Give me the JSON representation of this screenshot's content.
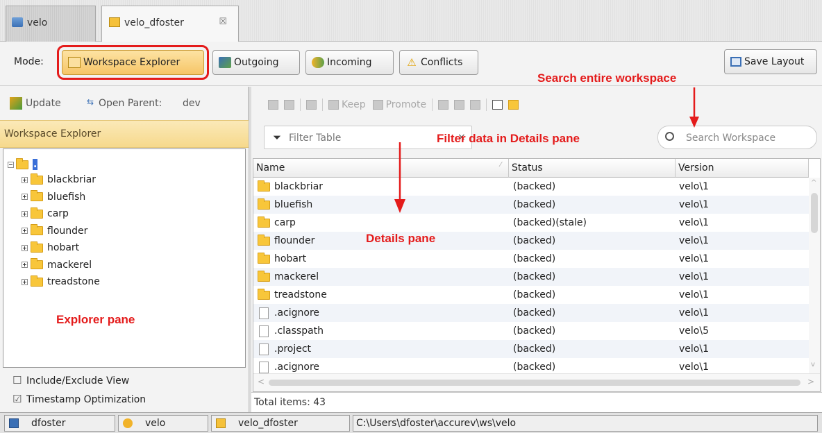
{
  "tabs": [
    {
      "label": "velo",
      "active": false
    },
    {
      "label": "velo_dfoster",
      "active": true,
      "close": "☒"
    }
  ],
  "mode": {
    "label": "Mode:",
    "buttons": [
      "Workspace Explorer",
      "Outgoing",
      "Incoming",
      "Conflicts"
    ],
    "selected": "Workspace Explorer",
    "save_layout": "Save Layout"
  },
  "left": {
    "update": "Update",
    "open_parent": "Open Parent:",
    "parent_name": "dev",
    "header": "Workspace Explorer",
    "root": ".",
    "tree": [
      "blackbriar",
      "bluefish",
      "carp",
      "flounder",
      "hobart",
      "mackerel",
      "treadstone"
    ],
    "include_exclude": "Include/Exclude View",
    "timestamp": "Timestamp Optimization"
  },
  "right": {
    "toolbar": {
      "keep": "Keep",
      "promote": "Promote"
    },
    "filter_placeholder": "Filter Table",
    "filter_clear": "×",
    "search_placeholder": "Search Workspace",
    "columns": [
      "Name",
      "Status",
      "Version"
    ],
    "rows": [
      {
        "name": "blackbriar",
        "status": "(backed)",
        "version": "velo\\1",
        "type": "folder"
      },
      {
        "name": "bluefish",
        "status": "(backed)",
        "version": "velo\\1",
        "type": "folder"
      },
      {
        "name": "carp",
        "status": "(backed)(stale)",
        "version": "velo\\1",
        "type": "folder"
      },
      {
        "name": "flounder",
        "status": "(backed)",
        "version": "velo\\1",
        "type": "folder"
      },
      {
        "name": "hobart",
        "status": "(backed)",
        "version": "velo\\1",
        "type": "folder"
      },
      {
        "name": "mackerel",
        "status": "(backed)",
        "version": "velo\\1",
        "type": "folder"
      },
      {
        "name": "treadstone",
        "status": "(backed)",
        "version": "velo\\1",
        "type": "folder"
      },
      {
        "name": ".acignore",
        "status": "(backed)",
        "version": "velo\\1",
        "type": "file"
      },
      {
        "name": ".classpath",
        "status": "(backed)",
        "version": "velo\\5",
        "type": "file"
      },
      {
        "name": ".project",
        "status": "(backed)",
        "version": "velo\\1",
        "type": "file"
      },
      {
        "name": ".acignore",
        "status": "(backed)",
        "version": "velo\\1",
        "type": "file"
      }
    ],
    "total": "Total items: 43"
  },
  "statusbar": {
    "user": "dfoster",
    "depot": "velo",
    "workspace": "velo_dfoster",
    "path": "C:\\Users\\dfoster\\accurev\\ws\\velo"
  },
  "annotations": {
    "search": "Search entire workspace",
    "filter": "Filter data in Details pane",
    "details": "Details pane",
    "explorer": "Explorer pane"
  },
  "colors": {
    "annotation": "#e41b1b",
    "highlight_border": "#e41b1b",
    "mode_selected": "#f8cd6e",
    "header": "#f6d98c"
  }
}
